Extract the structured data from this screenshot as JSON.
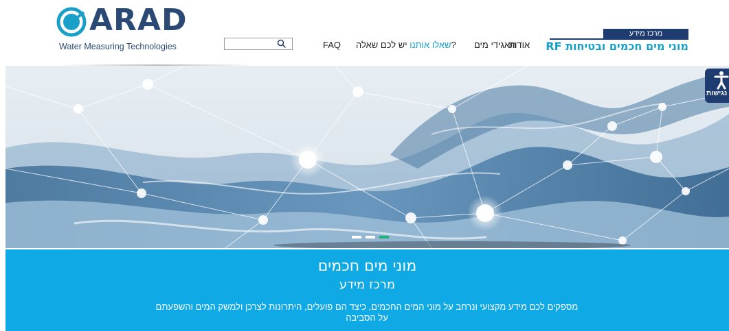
{
  "header": {
    "logo": {
      "wordmark": "ARAD",
      "tagline": "Water Measuring Technologies"
    },
    "search": {
      "placeholder": "",
      "value": ""
    },
    "nav": {
      "faq": "FAQ",
      "ask_link": "שאלו אותנו",
      "ask_prefix": "יש לכם שאלה?",
      "glossary": "תאגידי מים",
      "about": "אודות"
    },
    "brand": {
      "tag": "מרכז מידע",
      "title": "מוני מים חכמים ובטיחות RF"
    }
  },
  "accessibility": {
    "label": "נגישות"
  },
  "carousel": {
    "slides": 3,
    "active_slide": 3
  },
  "hero": {
    "title": "מוני מים חכמים",
    "subtitle": "מרכז מידע",
    "description_line1": "מספקים לכם מידע מקצועי ונרחב על מוני המים החכמים, כיצד הם פועלים, היתרונות לצרכן ולמשק המים והשפעתם",
    "description_line2": "על הסביבה"
  },
  "colors": {
    "brand_navy": "#1f3c70",
    "accent_cyan": "#1aa0c8",
    "hero_blue": "#0fa9e6",
    "active_dot": "#20b07a"
  }
}
